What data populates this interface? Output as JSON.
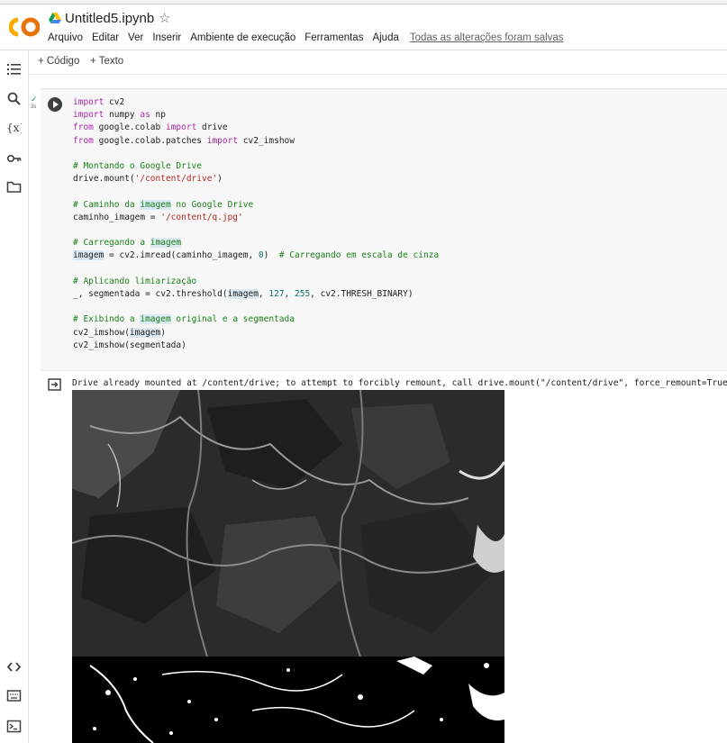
{
  "header": {
    "title": "Untitled5.ipynb",
    "star": "☆",
    "menu": [
      "Arquivo",
      "Editar",
      "Ver",
      "Inserir",
      "Ambiente de execução",
      "Ferramentas",
      "Ajuda"
    ],
    "saved_status": "Todas as alterações foram salvas"
  },
  "toolbar": {
    "add_code": "+ Código",
    "add_text": "+ Texto"
  },
  "sidebar": {
    "icons": [
      "table-of-contents-icon",
      "search-icon",
      "variables-icon",
      "secrets-key-icon",
      "files-folder-icon",
      "code-snippets-icon",
      "command-palette-icon",
      "terminal-icon"
    ]
  },
  "cell": {
    "status_check": "✓",
    "exec_time": "3s",
    "code_lines": [
      "import cv2",
      "import numpy as np",
      "from google.colab import drive",
      "from google.colab.patches import cv2_imshow",
      "",
      "# Montando o Google Drive",
      "drive.mount('/content/drive')",
      "",
      "# Caminho da imagem no Google Drive",
      "caminho_imagem = '/content/q.jpg'",
      "",
      "# Carregando a imagem",
      "imagem = cv2.imread(caminho_imagem, 0)  # Carregando em escala de cinza",
      "",
      "# Aplicando limiarização",
      "_, segmentada = cv2.threshold(imagem, 127, 255, cv2.THRESH_BINARY)",
      "",
      "# Exibindo a imagem original e a segmentada",
      "cv2_imshow(imagem)",
      "cv2_imshow(segmentada)"
    ]
  },
  "output": {
    "text": "Drive already mounted at /content/drive; to attempt to forcibly remount, call drive.mount(\"/content/drive\", force_remount=True"
  },
  "colors": {
    "keyword": "#a626a4",
    "comment": "#1a7f1a",
    "string": "#b3261e",
    "number": "#0b6e6e",
    "logo_orange": "#f9ab00",
    "logo_dark_orange": "#e8710a"
  }
}
